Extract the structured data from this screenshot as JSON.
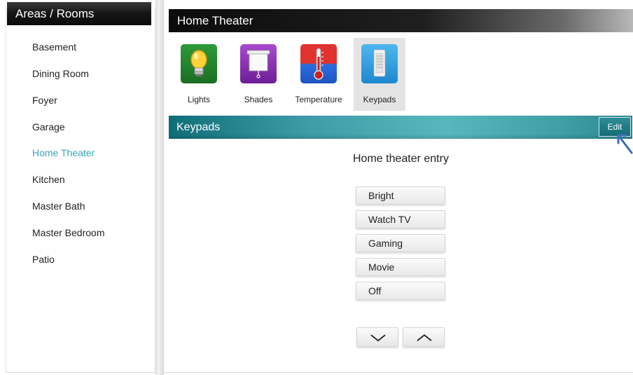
{
  "left_panel": {
    "title": "Areas / Rooms",
    "rooms": [
      "Basement",
      "Dining Room",
      "Foyer",
      "Garage",
      "Home Theater",
      "Kitchen",
      "Master Bath",
      "Master Bedroom",
      "Patio"
    ],
    "selected_room": "Home Theater"
  },
  "right_panel": {
    "title": "Home Theater",
    "categories": [
      {
        "label": "Lights",
        "icon": "light-bulb-icon"
      },
      {
        "label": "Shades",
        "icon": "shade-icon"
      },
      {
        "label": "Temperature",
        "icon": "thermometer-icon"
      },
      {
        "label": "Keypads",
        "icon": "keypad-icon"
      }
    ],
    "selected_category": "Keypads",
    "section_title": "Keypads",
    "edit_label": "Edit",
    "keypad_name": "Home theater entry",
    "keypad_buttons": [
      "Bright",
      "Watch TV",
      "Gaming",
      "Movie",
      "Off"
    ]
  },
  "colors": {
    "accent": "#3aa6b8",
    "section_bar": "#3e9ca6",
    "header_dark": "#151515"
  }
}
